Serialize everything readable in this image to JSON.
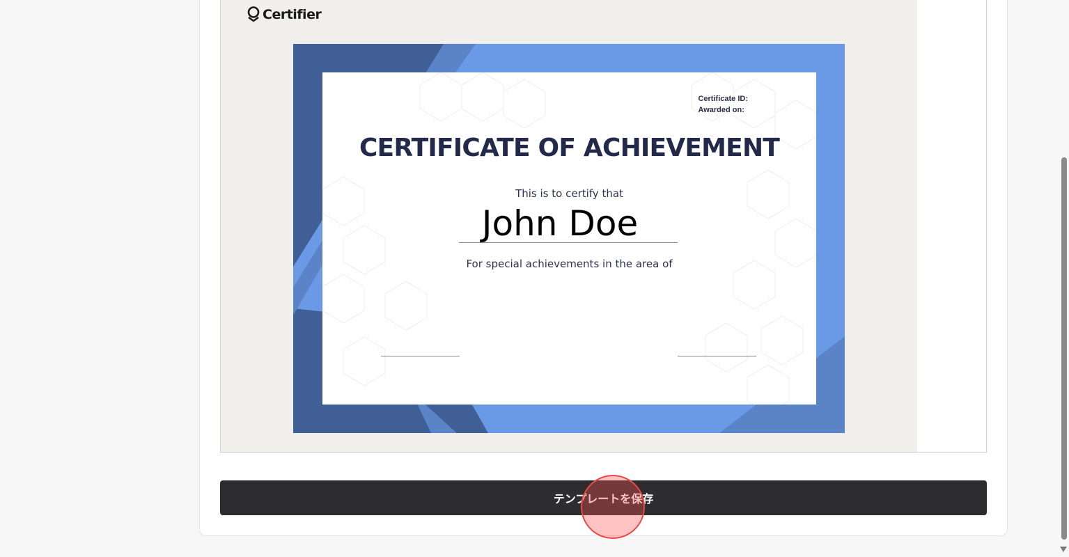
{
  "preview": {
    "brand_name": "Certifier",
    "certificate": {
      "certificate_id_label": "Certificate ID:",
      "awarded_on_label": "Awarded on:",
      "title": "CERTIFICATE OF ACHIEVEMENT",
      "certify_text": "This is to certify that",
      "recipient_name": "John Doe",
      "area_text": "For special achievements in the area of",
      "colors": {
        "dark_blue": "#3f5f96",
        "light_blue": "#6a9ae6",
        "mid_blue": "#5a83c8",
        "title_navy": "#22294b"
      }
    }
  },
  "actions": {
    "save_template_label": "テンプレートを保存"
  }
}
